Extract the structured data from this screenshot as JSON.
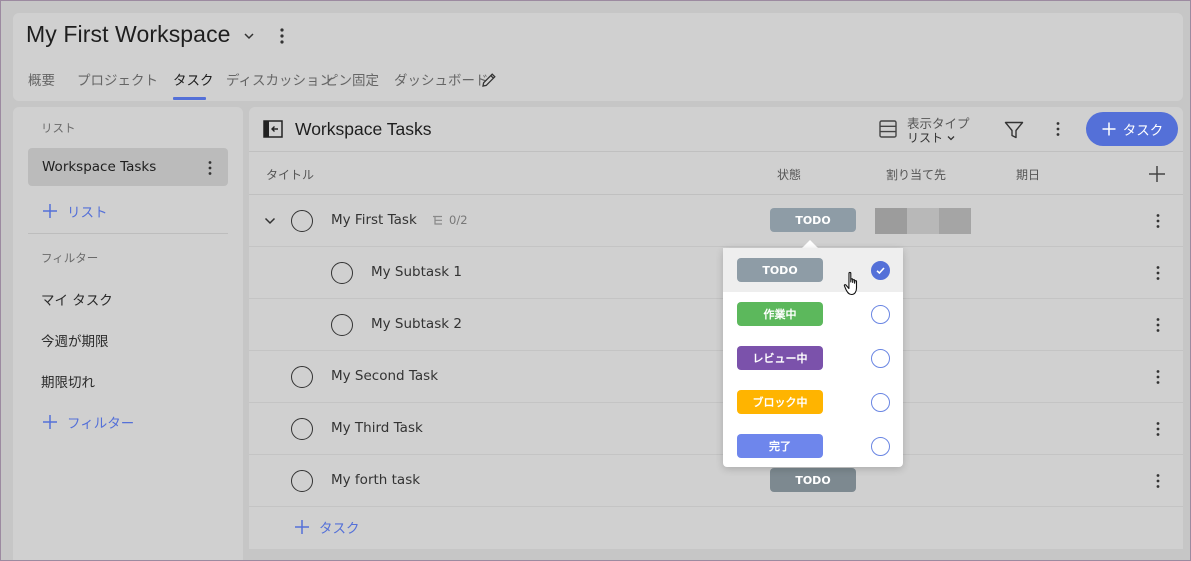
{
  "workspace": {
    "title": "My First Workspace"
  },
  "tabs": [
    {
      "label": "概要",
      "active": false
    },
    {
      "label": "プロジェクト",
      "active": false
    },
    {
      "label": "タスク",
      "active": true
    },
    {
      "label": "ディスカッション",
      "active": false
    },
    {
      "label": "ピン固定",
      "active": false
    },
    {
      "label": "ダッシュボード",
      "active": false
    }
  ],
  "sidebar": {
    "list_section": "リスト",
    "active_list": "Workspace Tasks",
    "add_list": "リスト",
    "filter_section": "フィルター",
    "filters": [
      "マイ タスク",
      "今週が期限",
      "期限切れ"
    ],
    "add_filter": "フィルター"
  },
  "main": {
    "title": "Workspace Tasks",
    "view_type_label": "表示タイプ",
    "view_type_value": "リスト",
    "add_task_button": "タスク",
    "columns": {
      "title": "タイトル",
      "status": "状態",
      "assignee": "割り当て先",
      "due": "期日"
    },
    "rows": [
      {
        "title": "My First Task",
        "subtasks": "0/2",
        "status": "TODO",
        "level": 0
      },
      {
        "title": "My Subtask 1",
        "level": 1
      },
      {
        "title": "My Subtask 2",
        "level": 1
      },
      {
        "title": "My Second Task",
        "level": 0
      },
      {
        "title": "My Third Task",
        "level": 0
      },
      {
        "title": "My forth task",
        "status": "TODO",
        "level": 0
      }
    ],
    "add_task_row": "タスク"
  },
  "status_dropdown": {
    "options": [
      {
        "label": "TODO",
        "color": "#8e9ca6",
        "selected": true
      },
      {
        "label": "作業中",
        "color": "#5cb85c",
        "selected": false
      },
      {
        "label": "レビュー中",
        "color": "#7b52ab",
        "selected": false
      },
      {
        "label": "ブロック中",
        "color": "#ffb400",
        "selected": false
      },
      {
        "label": "完了",
        "color": "#6e86ec",
        "selected": false
      }
    ]
  },
  "colors": {
    "accent": "#5470d8",
    "todo_pill": "#8e9ca6",
    "todo_pill_dim": "#7d8990"
  }
}
